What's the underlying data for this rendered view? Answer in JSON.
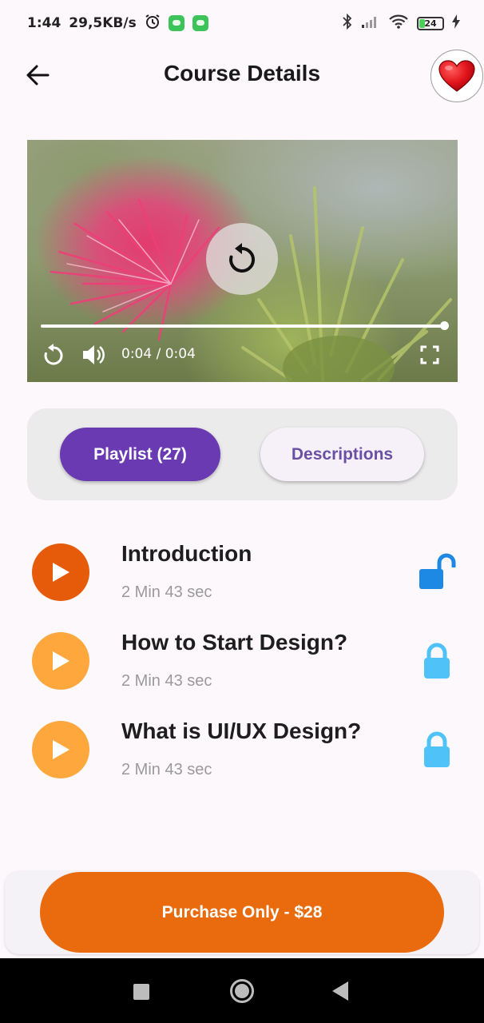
{
  "status_bar": {
    "time": "1:44",
    "speed": "29,5KB/s",
    "battery": "24",
    "icons": [
      "alarm-icon",
      "app-notification-icon",
      "app-notification-icon",
      "bluetooth-icon",
      "signal-icon",
      "wifi-icon",
      "battery-icon",
      "charging-icon"
    ]
  },
  "app_bar": {
    "title": "Course Details",
    "back_icon": "arrow-left-icon",
    "favorite_icon": "heart-icon"
  },
  "video": {
    "time_display": "0:04 / 0:04",
    "progress": 1.0,
    "center_icon": "replay-icon",
    "controls": [
      "replay-icon",
      "volume-icon",
      "fullscreen-icon"
    ]
  },
  "tabs": {
    "playlist": "Playlist (27)",
    "descriptions": "Descriptions",
    "selected": "playlist"
  },
  "lessons": [
    {
      "title": "Introduction",
      "duration": "2 Min 43 sec",
      "locked": false,
      "play_color": "#e55b0a",
      "lock_color": "#1e88e5"
    },
    {
      "title": "How to Start Design?",
      "duration": "2 Min 43 sec",
      "locked": true,
      "play_color": "#fda73c",
      "lock_color": "#4fc3f7"
    },
    {
      "title": "What is UI/UX Design?",
      "duration": "2 Min 43 sec",
      "locked": true,
      "play_color": "#fda73c",
      "lock_color": "#4fc3f7"
    }
  ],
  "purchase": {
    "label": "Purchase Only - $28"
  },
  "colors": {
    "primary": "#6a3ab2",
    "accent": "#e96b0e",
    "background": "#fdf8fc"
  },
  "nav_bar": {
    "icons": [
      "recents-square-icon",
      "home-circle-icon",
      "back-triangle-icon"
    ]
  }
}
